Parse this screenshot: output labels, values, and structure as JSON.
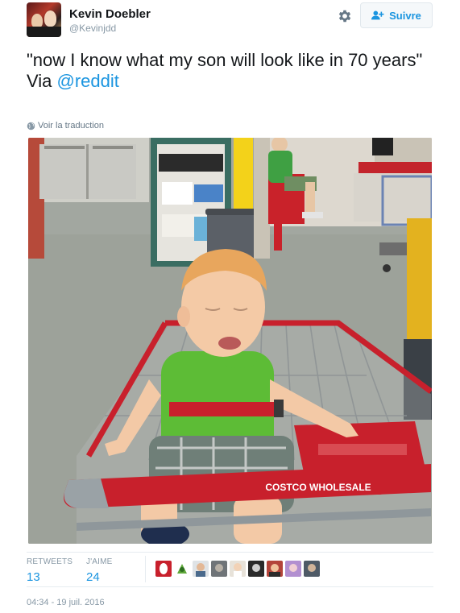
{
  "user": {
    "fullname": "Kevin Doebler",
    "handle": "@Kevinjdd",
    "follow_label": "Suivre"
  },
  "tweet": {
    "text_part1": "\"now I know what my son will look like in 70 years\"",
    "text_via": "Via ",
    "mention": "@reddit",
    "translate_label": "Voir la traduction"
  },
  "photo": {
    "sign_text": "COSTCO WHOLESALE"
  },
  "stats": {
    "retweets_label": "RETWEETS",
    "retweets_value": "13",
    "likes_label": "J'AIME",
    "likes_value": "24"
  },
  "likers": [
    "liker-1",
    "liker-2",
    "liker-3",
    "liker-4",
    "liker-5",
    "liker-6",
    "liker-7",
    "liker-8",
    "liker-9"
  ],
  "timestamp": "04:34 - 19 juil. 2016",
  "colors": {
    "link": "#1b95e0",
    "text": "#14171a",
    "muted": "#8899a6",
    "cart_red": "#c8202c",
    "shirt_green": "#64c23a"
  }
}
